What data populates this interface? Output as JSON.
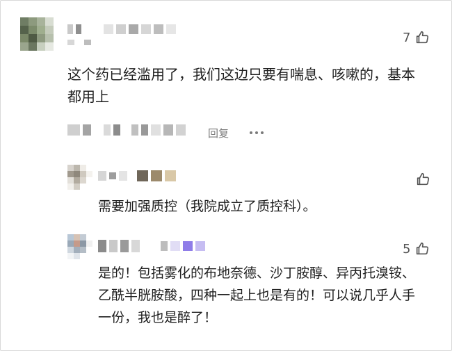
{
  "comments": [
    {
      "likes": "7",
      "text": "这个药已经滥用了，我们这边只要有喘息、咳嗽的，基本都用上",
      "reply_label": "回复"
    }
  ],
  "replies": [
    {
      "likes": "",
      "text": "需要加强质控（我院成立了质控科）。"
    },
    {
      "likes": "5",
      "text": "是的！包括雾化的布地奈德、沙丁胺醇、异丙托溴铵、乙酰半胱胺酸，四种一起上也是有的！可以说几乎人手一份，我也是醉了！"
    }
  ],
  "icons": {
    "like": "thumb-up-icon",
    "more": "more-dots-icon"
  },
  "colors": {
    "text": "#1f1f1f",
    "muted": "#7a7a7a"
  }
}
